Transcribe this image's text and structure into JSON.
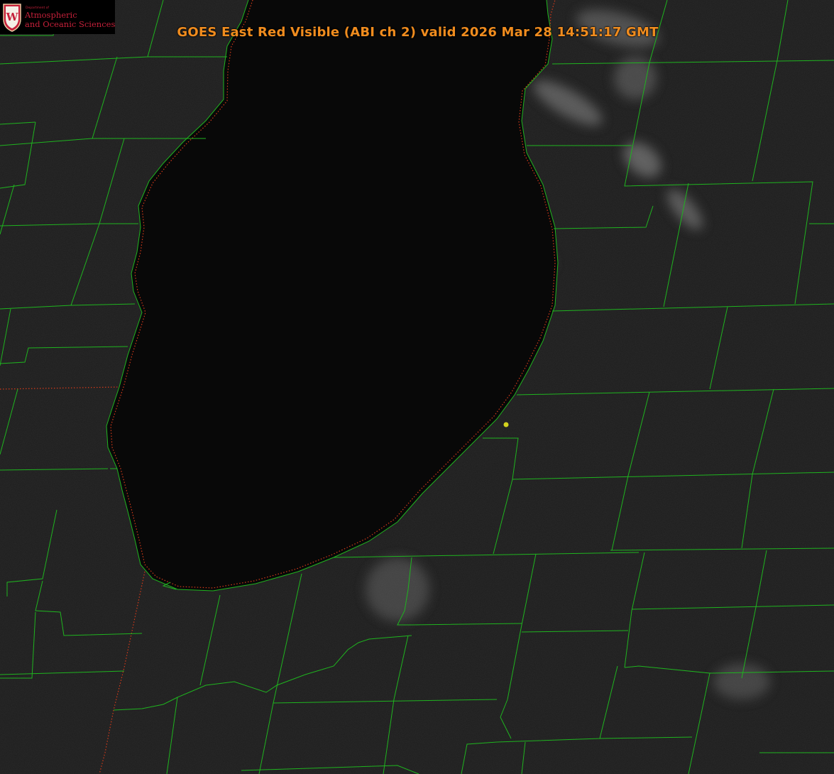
{
  "title": "GOES East Red Visible (ABI ch 2) valid 2026 Mar 28 14:51:17 GMT",
  "logo": {
    "dept_line": "Department of",
    "line1": "Atmospheric",
    "line2": "and Oceanic Sciences",
    "shield_letter": "W"
  },
  "colors": {
    "background_land": "#1c1c1c",
    "lake": "#080808",
    "county_lines": "#1fb41f",
    "state_border": "#d43a1a",
    "title": "#f08c1e",
    "marker": "#d2d21e",
    "logo_red": "#c5203a"
  }
}
